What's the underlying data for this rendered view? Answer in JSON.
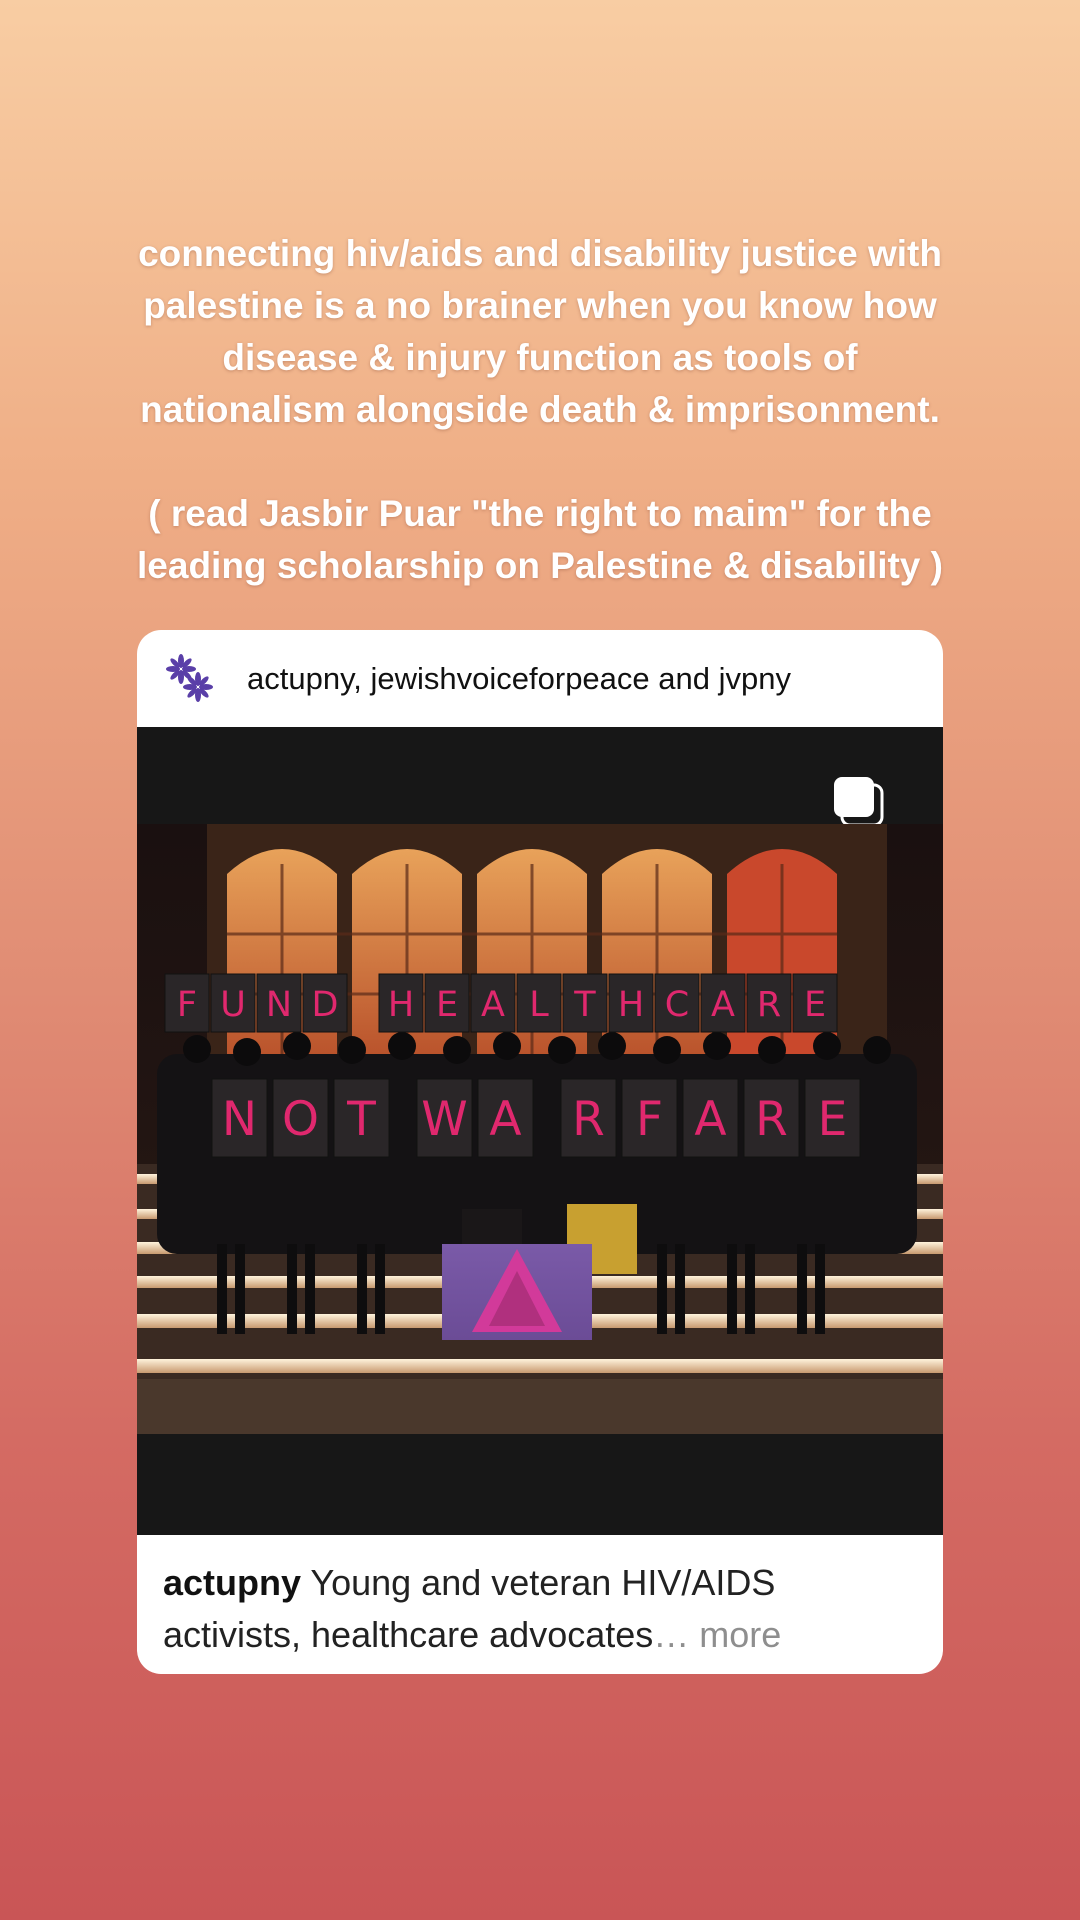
{
  "story": {
    "paragraph1": "connecting hiv/aids and disability justice with\npalestine is a no brainer when you know how\ndisease & injury function as tools of\nnationalism alongside death & imprisonment.",
    "paragraph2": "( read Jasbir Puar \"the right to maim\" for the\nleading scholarship on Palestine & disability )"
  },
  "post": {
    "header_users": "actupny, jewishvoiceforpeace and jvpny",
    "avatar_icon": "flower-logo-icon",
    "media_type_icon": "multiple-images-icon",
    "photo": {
      "sign_row1": [
        "F",
        "U",
        "N",
        "D",
        "H",
        "E",
        "A",
        "L",
        "T",
        "H",
        "C",
        "A",
        "R",
        "E"
      ],
      "sign_row2": [
        "N",
        "O",
        "T",
        "W",
        "A",
        "R",
        "F",
        "A",
        "R",
        "E"
      ]
    },
    "caption_user": "actupny",
    "caption_text": " Young and veteran HIV/AIDS activists, healthcare advocates",
    "caption_ellipsis": "…",
    "caption_more": " more"
  },
  "colors": {
    "gradient_top": "#f8cda3",
    "gradient_bottom": "#c95556",
    "sign_letter": "#e0286e",
    "avatar_purple": "#5a3fa8"
  }
}
